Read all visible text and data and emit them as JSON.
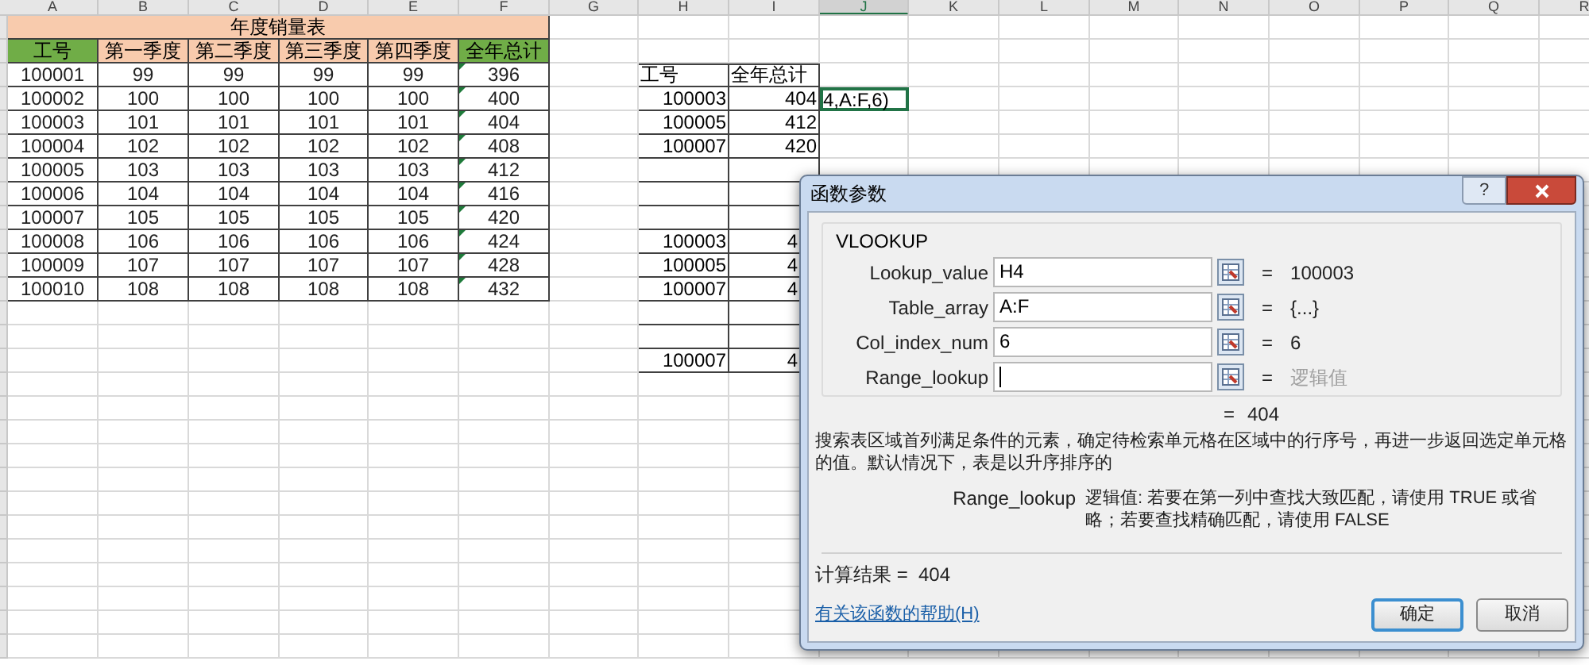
{
  "column_headers": [
    "A",
    "B",
    "C",
    "D",
    "E",
    "F",
    "G",
    "H",
    "I",
    "J",
    "K",
    "L",
    "M",
    "N",
    "O",
    "P",
    "Q",
    "R"
  ],
  "sales_table": {
    "title": "年度销量表",
    "headers": [
      {
        "text": "工号",
        "color": "#70ad47"
      },
      {
        "text": "第一季度",
        "color": "#f8cbad"
      },
      {
        "text": "第二季度",
        "color": "#f8cbad"
      },
      {
        "text": "第三季度",
        "color": "#f8cbad"
      },
      {
        "text": "第四季度",
        "color": "#f8cbad"
      },
      {
        "text": "全年总计",
        "color": "#70ad47"
      }
    ],
    "rows": [
      {
        "cells": [
          "100001",
          "99",
          "99",
          "99",
          "99",
          "396"
        ],
        "flagged": true
      },
      {
        "cells": [
          "100002",
          "100",
          "100",
          "100",
          "100",
          "400"
        ],
        "flagged": true
      },
      {
        "cells": [
          "100003",
          "101",
          "101",
          "101",
          "101",
          "404"
        ],
        "flagged": true
      },
      {
        "cells": [
          "100004",
          "102",
          "102",
          "102",
          "102",
          "408"
        ],
        "flagged": true
      },
      {
        "cells": [
          "100005",
          "103",
          "103",
          "103",
          "103",
          "412"
        ],
        "flagged": true
      },
      {
        "cells": [
          "100006",
          "104",
          "104",
          "104",
          "104",
          "416"
        ],
        "flagged": true
      },
      {
        "cells": [
          "100007",
          "105",
          "105",
          "105",
          "105",
          "420"
        ],
        "flagged": true
      },
      {
        "cells": [
          "100008",
          "106",
          "106",
          "106",
          "106",
          "424"
        ],
        "flagged": true
      },
      {
        "cells": [
          "100009",
          "107",
          "107",
          "107",
          "107",
          "428"
        ],
        "flagged": true
      },
      {
        "cells": [
          "100010",
          "108",
          "108",
          "108",
          "108",
          "432"
        ],
        "flagged": true
      }
    ]
  },
  "lookup_table": {
    "headers": [
      "工号",
      "全年总计"
    ],
    "rows": [
      {
        "kind": "data",
        "id": "100003",
        "total": "404"
      },
      {
        "kind": "data",
        "id": "100005",
        "total": "412"
      },
      {
        "kind": "data",
        "id": "100007",
        "total": "420"
      },
      {
        "kind": "blank"
      },
      {
        "kind": "blank"
      },
      {
        "kind": "blank"
      },
      {
        "kind": "partial",
        "id": "100003",
        "total": "4"
      },
      {
        "kind": "partial",
        "id": "100005",
        "total": "4"
      },
      {
        "kind": "partial",
        "id": "100007",
        "total": "4"
      },
      {
        "kind": "blank"
      },
      {
        "kind": "blank"
      },
      {
        "kind": "partial",
        "id": "100007",
        "total": "4"
      }
    ]
  },
  "active_cell": {
    "text": "4,A:F,6)",
    "selected": true
  },
  "dialog": {
    "title": "函数参数",
    "help_button": "?",
    "function_name": "VLOOKUP",
    "arguments": [
      {
        "label": "Lookup_value",
        "value": "H4",
        "equals": "=",
        "result": "100003",
        "muted": false,
        "focused": false
      },
      {
        "label": "Table_array",
        "value": "A:F",
        "equals": "=",
        "result": "{...}",
        "muted": false,
        "focused": false
      },
      {
        "label": "Col_index_num",
        "value": "6",
        "equals": "=",
        "result": "6",
        "muted": false,
        "focused": false
      },
      {
        "label": "Range_lookup",
        "equals": "=",
        "result": "逻辑值",
        "muted": true,
        "focused": true
      }
    ],
    "formula_equals": "=",
    "formula_value": "404",
    "description": "搜索表区域首列满足条件的元素，确定待检索单元格在区域中的行序号，再进一步返回选定单元格的值。默认情况下，表是以升序排序的",
    "arg_help": {
      "name": "Range_lookup",
      "text": "逻辑值: 若要在第一列中查找大致匹配，请使用 TRUE 或省略；若要查找精确匹配，请使用 FALSE"
    },
    "result_text": "计算结果 =  404",
    "help_link": "有关该函数的帮助(H)",
    "buttons": [
      {
        "label": "确定",
        "default": true
      },
      {
        "label": "取消",
        "default": false
      }
    ]
  }
}
